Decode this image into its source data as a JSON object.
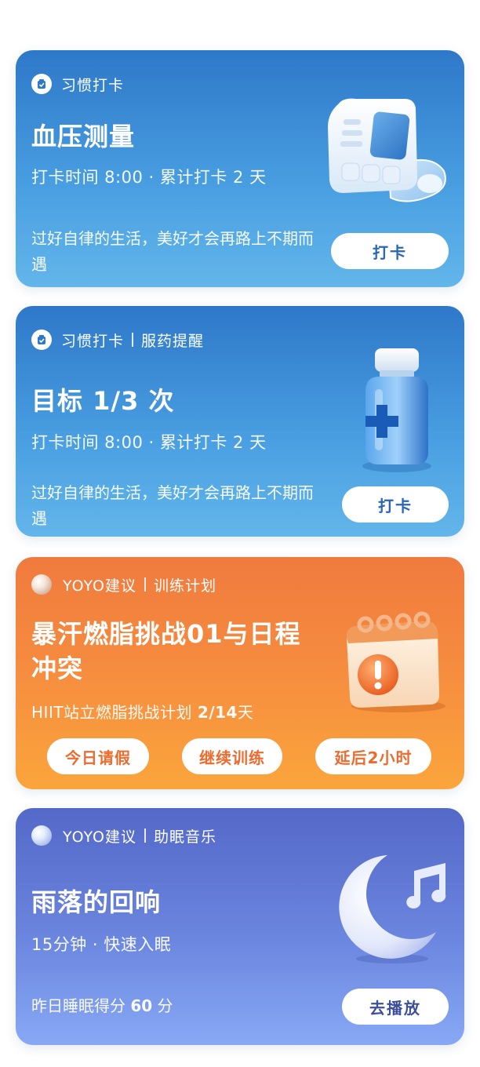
{
  "cards": [
    {
      "header": "习惯打卡",
      "title": "血压测量",
      "subtitle": "打卡时间 8:00 · 累计打卡 2 天",
      "note": "过好自律的生活，美好才会再路上不期而遇",
      "button": "打卡",
      "illustration": "blood-pressure-monitor-icon"
    },
    {
      "header": "习惯打卡",
      "header_tag": "服药提醒",
      "title": "目标 1/3 次",
      "subtitle": "打卡时间 8:00 · 累计打卡 2 天",
      "note": "过好自律的生活，美好才会再路上不期而遇",
      "button": "打卡",
      "illustration": "medicine-bottle-icon"
    },
    {
      "header": "YOYO建议",
      "header_tag": "训练计划",
      "title": "暴汗燃脂挑战01与日程冲突",
      "subtitle_prefix": "HIIT站立燃脂挑战计划 ",
      "subtitle_value": "2/14",
      "subtitle_suffix": "天",
      "buttons": [
        "今日请假",
        "继续训练",
        "延后2小时"
      ],
      "illustration": "calendar-alert-icon"
    },
    {
      "header": "YOYO建议",
      "header_tag": "助眠音乐",
      "title": "雨落的回响",
      "subtitle": "15分钟 · 快速入眠",
      "note_prefix": "昨日睡眠得分 ",
      "note_value": "60",
      "note_suffix": " 分",
      "button": "去播放",
      "illustration": "moon-music-icon"
    }
  ],
  "colors": {
    "blue_top": "#2e78c9",
    "blue_bottom": "#63b6ea",
    "orange_top": "#f07a3e",
    "orange_bottom": "#fba53c",
    "purple_top": "#5468c8",
    "purple_bottom": "#88a8f5"
  }
}
